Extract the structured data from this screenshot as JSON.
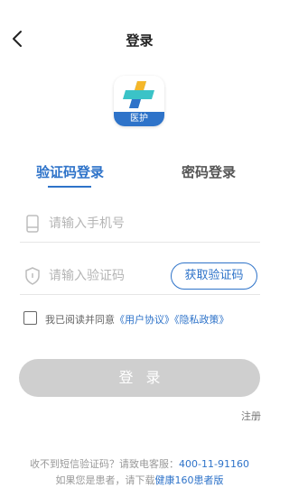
{
  "header": {
    "back_icon": "chevron-left-icon",
    "title": "登录"
  },
  "logo": {
    "badge_text": "医护",
    "colors": {
      "blue": "#2e73c9",
      "yellow": "#f5b72a",
      "teal": "#3bc3c7"
    }
  },
  "tabs": [
    {
      "label": "验证码登录",
      "active": true
    },
    {
      "label": "密码登录",
      "active": false
    }
  ],
  "phone_field": {
    "icon": "phone-icon",
    "placeholder": "请输入手机号",
    "value": ""
  },
  "code_field": {
    "icon": "shield-icon",
    "placeholder": "请输入验证码",
    "value": ""
  },
  "get_code_label": "获取验证码",
  "agreement": {
    "checked": false,
    "prefix": "我已阅读并同意",
    "user_agreement": "《用户协议》",
    "privacy_policy": "《隐私政策》"
  },
  "login_label": "登录",
  "register_label": "注册",
  "footer": {
    "line1_prefix": "收不到短信验证码？请致电客服：",
    "phone": "400-11-91160",
    "line2_prefix": "如果您是患者，请下载",
    "app_name": "健康160患者版"
  },
  "colors": {
    "accent": "#2e73c9",
    "button_disabled": "#cfcfcf"
  }
}
